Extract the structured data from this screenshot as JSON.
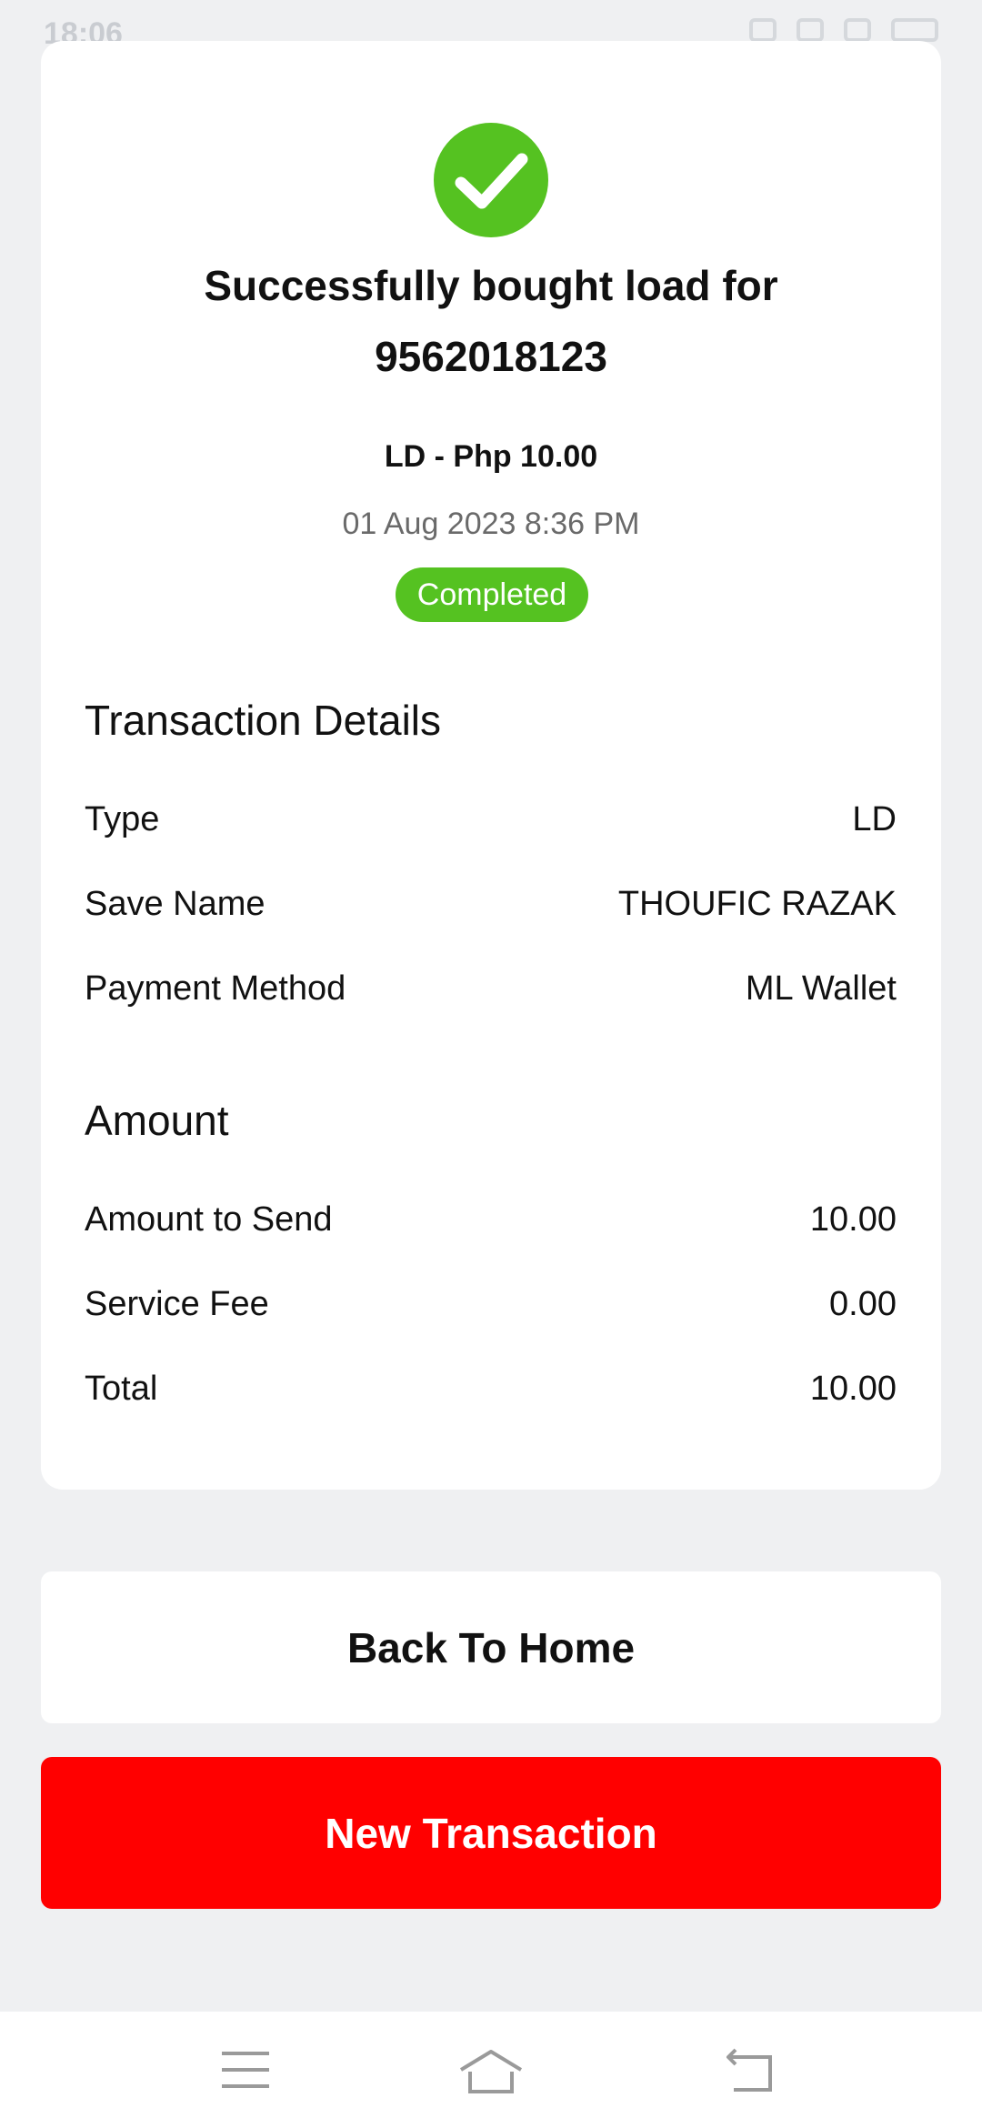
{
  "status_bar": {
    "time": "18:06"
  },
  "receipt": {
    "icon": "check-circle-icon",
    "headline_line1": "Successfully bought load for",
    "headline_line2": "9562018123",
    "product": "LD - Php 10.00",
    "datetime": "01 Aug 2023 8:36 PM",
    "status": "Completed",
    "colors": {
      "success": "#55c221",
      "primary": "#ff0000"
    }
  },
  "transaction_details": {
    "title": "Transaction Details",
    "rows": [
      {
        "label": "Type",
        "value": "LD"
      },
      {
        "label": "Save Name",
        "value": "THOUFIC RAZAK"
      },
      {
        "label": "Payment Method",
        "value": "ML Wallet"
      }
    ]
  },
  "amount": {
    "title": "Amount",
    "rows": [
      {
        "label": "Amount to Send",
        "value": "10.00"
      },
      {
        "label": "Service Fee",
        "value": "0.00"
      },
      {
        "label": "Total",
        "value": "10.00"
      }
    ]
  },
  "actions": {
    "back_home": "Back To Home",
    "new_transaction": "New Transaction"
  },
  "nav": {
    "icons": [
      "menu-icon",
      "home-icon",
      "back-icon"
    ]
  }
}
